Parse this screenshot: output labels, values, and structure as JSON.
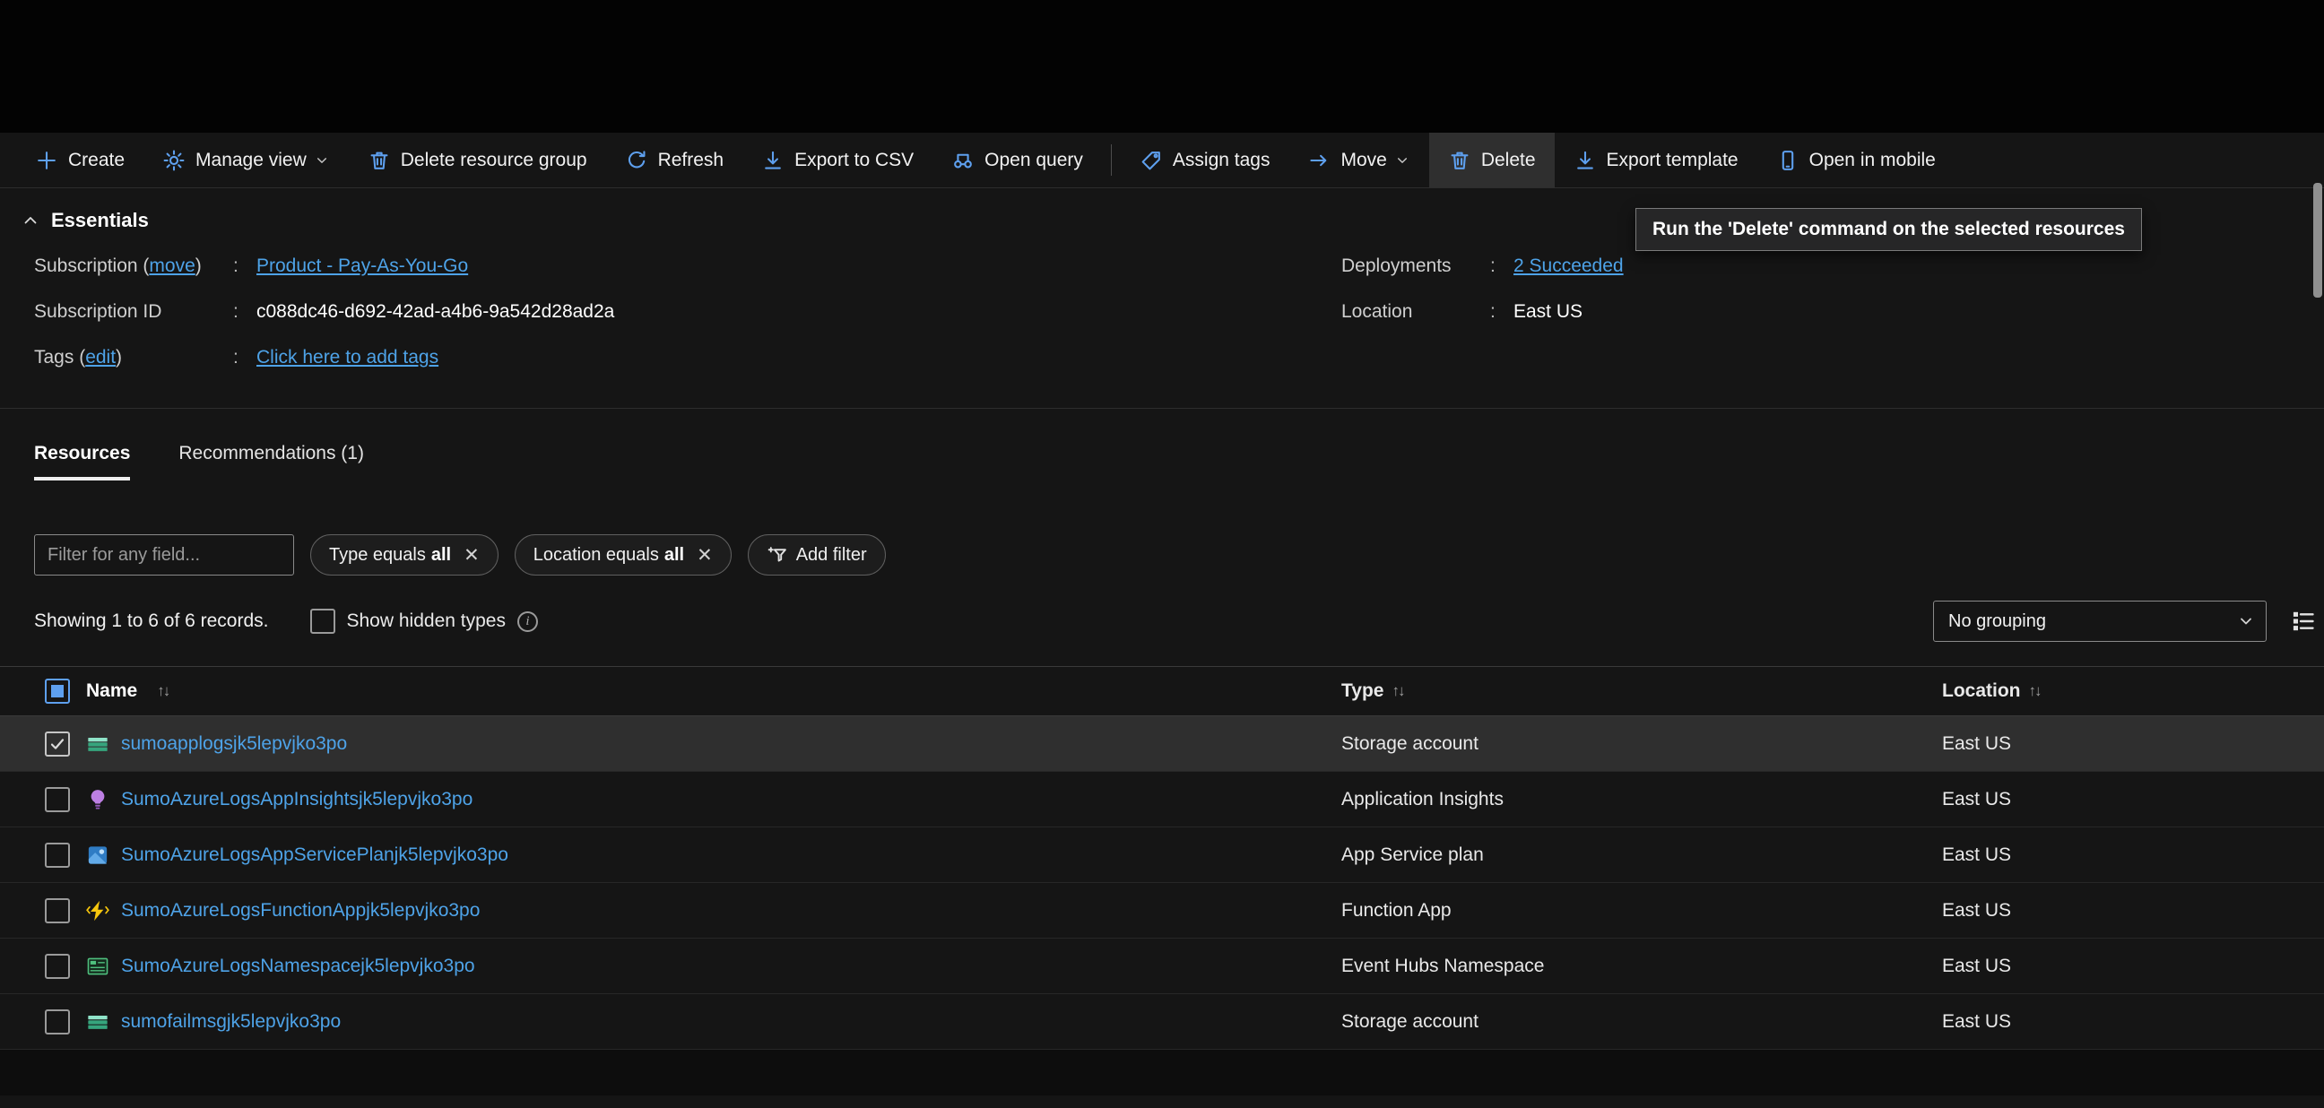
{
  "toolbar": {
    "items": [
      {
        "label": "Create",
        "icon": "plus"
      },
      {
        "label": "Manage view",
        "icon": "gear",
        "chevron": true
      },
      {
        "label": "Delete resource group",
        "icon": "trash"
      },
      {
        "label": "Refresh",
        "icon": "refresh"
      },
      {
        "label": "Export to CSV",
        "icon": "download"
      },
      {
        "label": "Open query",
        "icon": "query"
      },
      {
        "separator": true
      },
      {
        "label": "Assign tags",
        "icon": "tag"
      },
      {
        "label": "Move",
        "icon": "arrow-right",
        "chevron": true
      },
      {
        "label": "Delete",
        "icon": "trash",
        "active": true
      },
      {
        "label": "Export template",
        "icon": "download"
      },
      {
        "label": "Open in mobile",
        "icon": "mobile"
      }
    ],
    "tooltip": "Run the 'Delete' command on the selected resources"
  },
  "essentials": {
    "title": "Essentials",
    "left": [
      {
        "label_pre": "Subscription (",
        "label_link": "move",
        "label_post": ")",
        "value": "Product - Pay-As-You-Go",
        "value_link": true
      },
      {
        "label_pre": "Subscription ID",
        "value": "c088dc46-d692-42ad-a4b6-9a542d28ad2a"
      },
      {
        "label_pre": "Tags (",
        "label_link": "edit",
        "label_post": ")",
        "value": "Click here to add tags",
        "value_link": true,
        "tags_row": true
      }
    ],
    "right": [
      {
        "label_pre": "Deployments",
        "value": "2 Succeeded",
        "value_link": true
      },
      {
        "label_pre": "Location",
        "value": "East US"
      }
    ]
  },
  "tabs": [
    {
      "label": "Resources",
      "active": true
    },
    {
      "label": "Recommendations (1)",
      "active": false
    }
  ],
  "filters": {
    "search_placeholder": "Filter for any field...",
    "pills": [
      {
        "text": "Type equals",
        "bold": "all"
      },
      {
        "text": "Location equals",
        "bold": "all"
      }
    ],
    "add_filter_label": "Add filter"
  },
  "table_meta": {
    "showing": "Showing 1 to 6 of 6 records.",
    "show_hidden_label": "Show hidden types",
    "grouping": "No grouping"
  },
  "table": {
    "columns": [
      {
        "label": "Name"
      },
      {
        "label": "Type"
      },
      {
        "label": "Location"
      }
    ],
    "rows": [
      {
        "name": "sumoapplogsjk5lepvjko3po",
        "type": "Storage account",
        "location": "East US",
        "icon": "storage",
        "checked": true,
        "selected": true
      },
      {
        "name": "SumoAzureLogsAppInsightsjk5lepvjko3po",
        "type": "Application Insights",
        "location": "East US",
        "icon": "insights",
        "checked": false
      },
      {
        "name": "SumoAzureLogsAppServicePlanjk5lepvjko3po",
        "type": "App Service plan",
        "location": "East US",
        "icon": "app-service",
        "checked": false
      },
      {
        "name": "SumoAzureLogsFunctionAppjk5lepvjko3po",
        "type": "Function App",
        "location": "East US",
        "icon": "function",
        "checked": false
      },
      {
        "name": "SumoAzureLogsNamespacejk5lepvjko3po",
        "type": "Event Hubs Namespace",
        "location": "East US",
        "icon": "event-hubs",
        "checked": false
      },
      {
        "name": "sumofailmsgjk5lepvjko3po",
        "type": "Storage account",
        "location": "East US",
        "icon": "storage",
        "checked": false
      }
    ]
  },
  "colors": {
    "accent_blue": "#5ea0ef",
    "link_blue": "#4ea3e8",
    "selected_row": "#2f2f2f"
  }
}
